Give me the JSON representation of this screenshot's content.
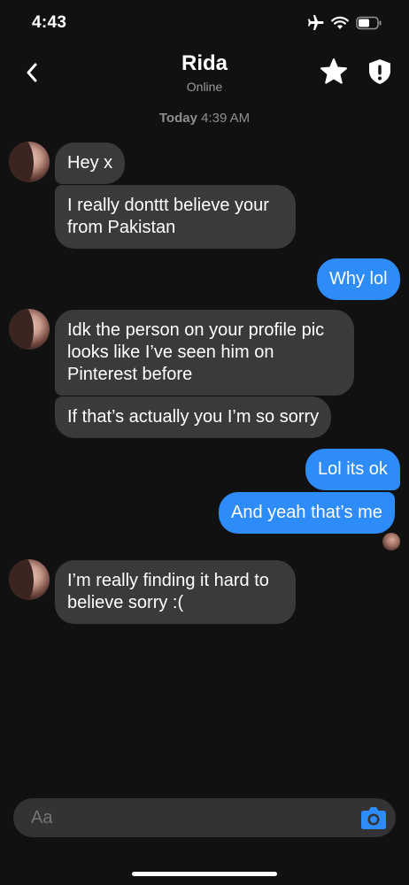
{
  "status_bar": {
    "time": "4:43"
  },
  "header": {
    "name": "Rida",
    "status": "Online"
  },
  "divider": {
    "day": "Today",
    "time": "4:39 AM"
  },
  "messages": [
    {
      "from": "them",
      "text": "Hey x"
    },
    {
      "from": "them",
      "text": "I really donttt believe your from Pakistan"
    },
    {
      "from": "me",
      "text": "Why lol"
    },
    {
      "from": "them",
      "text": "Idk the person on your profile pic looks like I’ve seen him on Pinterest before"
    },
    {
      "from": "them",
      "text": "If that’s actually you I’m so sorry"
    },
    {
      "from": "me",
      "text": "Lol its ok"
    },
    {
      "from": "me",
      "text": "And yeah that’s me"
    },
    {
      "from": "them",
      "text": "I’m really finding it hard to believe sorry :("
    }
  ],
  "composer": {
    "placeholder": "Aa"
  },
  "colors": {
    "incoming_bubble": "#3a3a3c",
    "outgoing_bubble": "#2d8cf7",
    "accent": "#2d8cf7"
  }
}
